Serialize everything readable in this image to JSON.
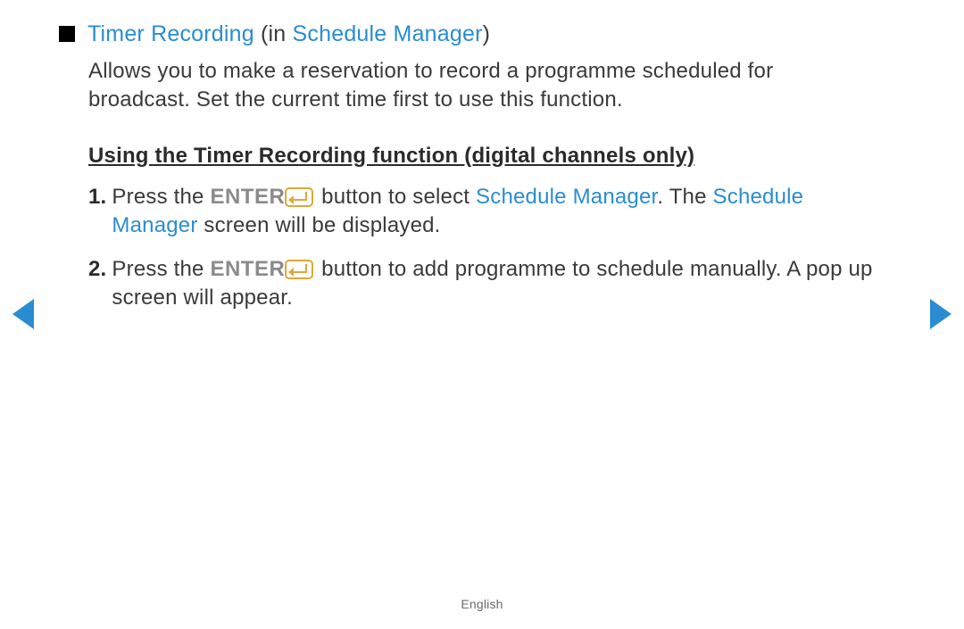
{
  "heading": {
    "part1": "Timer Recording",
    "part2": " (in ",
    "part3": "Schedule Manager",
    "part4": ")"
  },
  "intro": "Allows you to make a reservation to record a programme scheduled for broadcast. Set the current time first to use this function.",
  "subheading": "Using the Timer Recording function (digital channels only)",
  "steps": [
    {
      "num": "1.",
      "t1": "Press the ",
      "enter": "ENTER",
      "t2": " button to select ",
      "blue1": "Schedule Manager",
      "t3": ". The ",
      "blue2": "Schedule Manager",
      "t4": " screen will be displayed."
    },
    {
      "num": "2.",
      "t1": "Press the ",
      "enter": "ENTER",
      "t2": " button to add programme to schedule manually. A pop up screen will appear."
    }
  ],
  "footer_lang": "English"
}
